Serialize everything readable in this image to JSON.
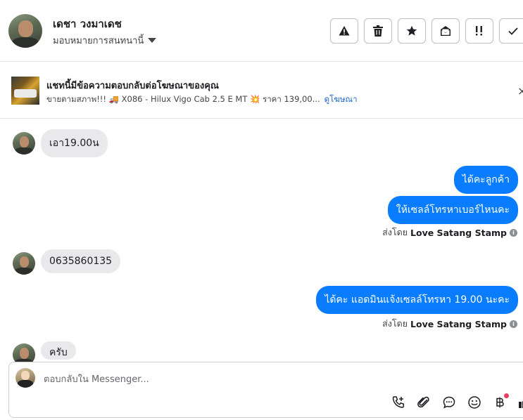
{
  "header": {
    "contact_name": "เดชา วงมาเดช",
    "assign_label": "มอบหมายการสนทนานี้",
    "actions": [
      "warning-icon",
      "trash-icon",
      "star-icon",
      "mail-open-icon",
      "priority-icon",
      "check-icon"
    ]
  },
  "ad": {
    "title": "แชทนี้มีข้อความตอบกลับต่อโฆษณาของคุณ",
    "summary": "ขายตามสภาพ!!! 🚚 X086 - Hilux Vigo Cab 2.5 E MT 💥 ราคา 139,00...",
    "link": "ดูโฆษณา",
    "close": "×"
  },
  "messages": [
    {
      "direction": "in",
      "text": "เอา19.00น"
    },
    {
      "direction": "out",
      "text": "ได้คะลูกค้า"
    },
    {
      "direction": "out",
      "text": "ให้เซลล์โทรหาเบอร์ไหนคะ"
    },
    {
      "direction": "in",
      "text": "0635860135"
    },
    {
      "direction": "out",
      "text": "ได้คะ แอดมินแจ้งเซลล์โทรหา 19.00 นะคะ"
    },
    {
      "direction": "in",
      "text": "ครับ"
    }
  ],
  "sent_by": {
    "prefix": "ส่งโดย",
    "sender": "Love Satang Stamp",
    "info": "i"
  },
  "composer": {
    "placeholder": "ตอบกลับใน Messenger...",
    "tools": [
      "phone-plus-icon",
      "paperclip-icon",
      "chat-bubble-icon",
      "emoji-icon",
      "baht-icon",
      "thumbs-up-icon"
    ]
  },
  "colors": {
    "accent": "#0a7cff",
    "incoming_bubble": "#e9e9eb",
    "link": "#1a66c8"
  }
}
